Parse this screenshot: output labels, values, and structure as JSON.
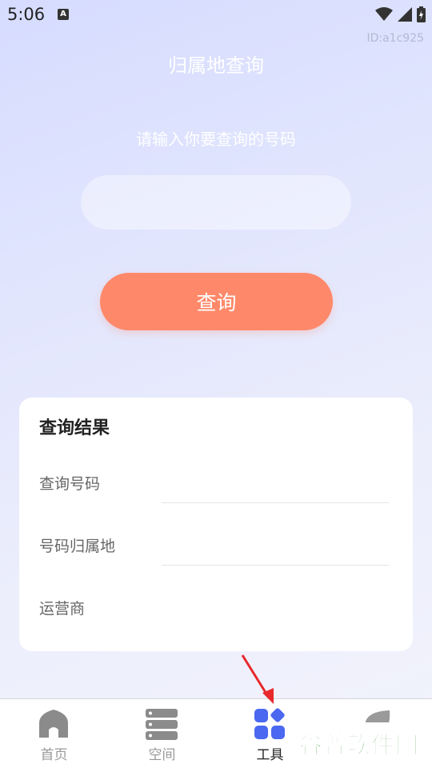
{
  "status_bar": {
    "time": "5:06",
    "a_icon": "A"
  },
  "id_tag": "ID:a1c925",
  "page": {
    "title": "归属地查询",
    "prompt": "请输入你要查询的号码",
    "input_value": "",
    "query_button": "查询"
  },
  "result": {
    "title": "查询结果",
    "rows": [
      {
        "label": "查询号码",
        "value": ""
      },
      {
        "label": "号码归属地",
        "value": ""
      },
      {
        "label": "运营商",
        "value": ""
      }
    ]
  },
  "nav": {
    "items": [
      {
        "label": "首页",
        "icon": "home-icon"
      },
      {
        "label": "空间",
        "icon": "storage-icon"
      },
      {
        "label": "工具",
        "icon": "tools-icon",
        "active": true
      },
      {
        "label": "",
        "icon": "leaf-icon"
      }
    ]
  },
  "watermark": "谷普软件园",
  "colors": {
    "accent": "#fe896a",
    "tab_active": "#4a68f0"
  }
}
